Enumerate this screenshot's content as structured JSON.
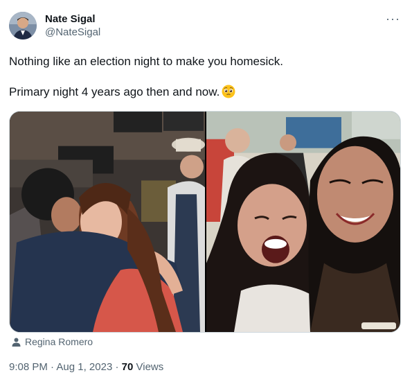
{
  "tweet": {
    "author_name": "Nate Sigal",
    "author_handle": "@NateSigal",
    "more_icon": "more-horizontal-icon",
    "text_line1": "Nothing like an election night to make you homesick.",
    "text_line2": "Primary night 4 years ago then and now.",
    "emoji": "pleading-face-emoji",
    "photo_tag": "Regina Romero",
    "time": "9:08 PM",
    "separator": "·",
    "date": "Aug 1, 2023",
    "views_count": "70",
    "views_label": "Views"
  }
}
